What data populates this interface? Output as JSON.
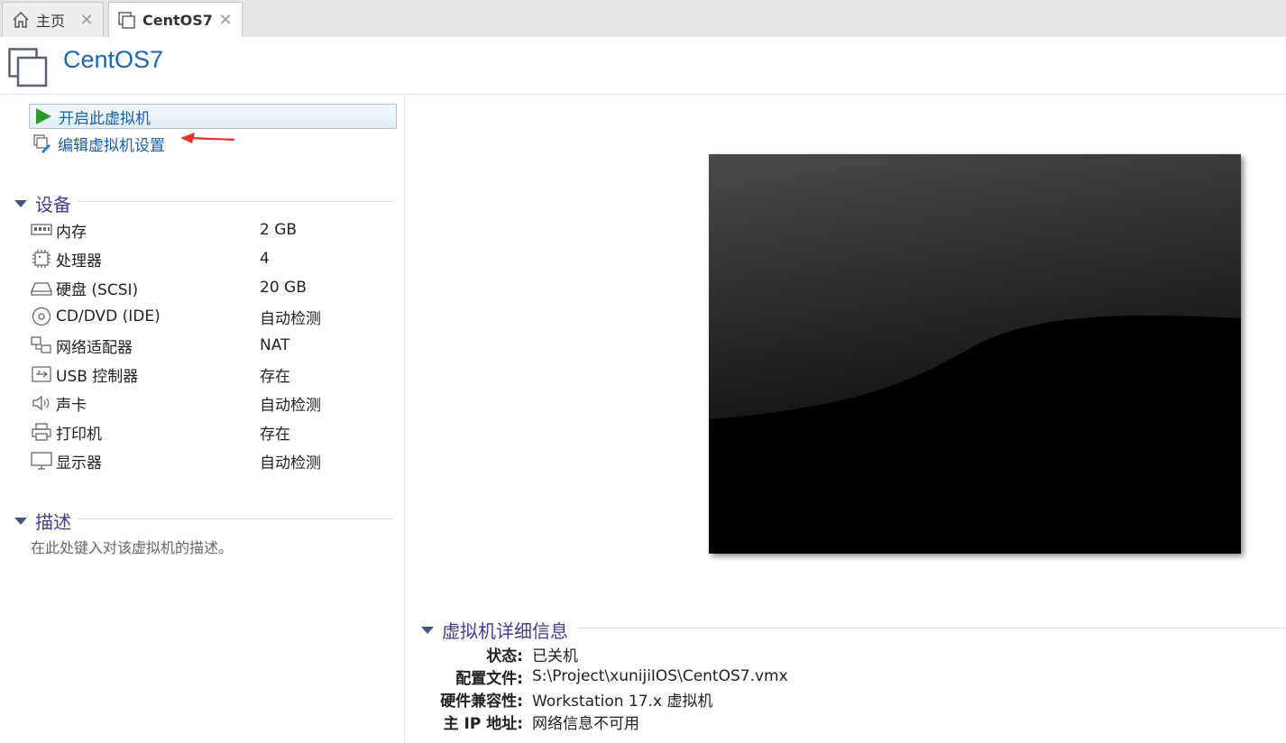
{
  "tabs": [
    {
      "label": "主页",
      "icon": "home-icon"
    },
    {
      "label": "CentOS7",
      "icon": "vm-icon"
    }
  ],
  "header": {
    "title": "CentOS7"
  },
  "actions": {
    "power_on": "开启此虚拟机",
    "edit_settings": "编辑虚拟机设置"
  },
  "devices": {
    "title": "设备",
    "items": [
      {
        "name": "内存",
        "value": "2 GB",
        "icon": "memory-icon"
      },
      {
        "name": "处理器",
        "value": "4",
        "icon": "cpu-icon"
      },
      {
        "name": "硬盘 (SCSI)",
        "value": "20 GB",
        "icon": "harddisk-icon"
      },
      {
        "name": "CD/DVD (IDE)",
        "value": "自动检测",
        "icon": "cd-icon"
      },
      {
        "name": "网络适配器",
        "value": "NAT",
        "icon": "network-icon"
      },
      {
        "name": "USB 控制器",
        "value": "存在",
        "icon": "usb-icon"
      },
      {
        "name": "声卡",
        "value": "自动检测",
        "icon": "speaker-icon"
      },
      {
        "name": "打印机",
        "value": "存在",
        "icon": "printer-icon"
      },
      {
        "name": "显示器",
        "value": "自动检测",
        "icon": "monitor-icon"
      }
    ]
  },
  "description": {
    "title": "描述",
    "placeholder": "在此处键入对该虚拟机的描述。"
  },
  "details": {
    "title": "虚拟机详细信息",
    "rows": [
      {
        "key": "状态:",
        "value": "已关机"
      },
      {
        "key": "配置文件:",
        "value": "S:\\Project\\xunijiIOS\\CentOS7.vmx"
      },
      {
        "key": "硬件兼容性:",
        "value": "Workstation 17.x 虚拟机"
      },
      {
        "key": "主 IP 地址:",
        "value": "网络信息不可用"
      }
    ]
  },
  "colors": {
    "accent": "#1a66b8",
    "section_title": "#4a3a8c",
    "play_green": "#2e9b2e",
    "annotation_red": "#e8312f"
  }
}
